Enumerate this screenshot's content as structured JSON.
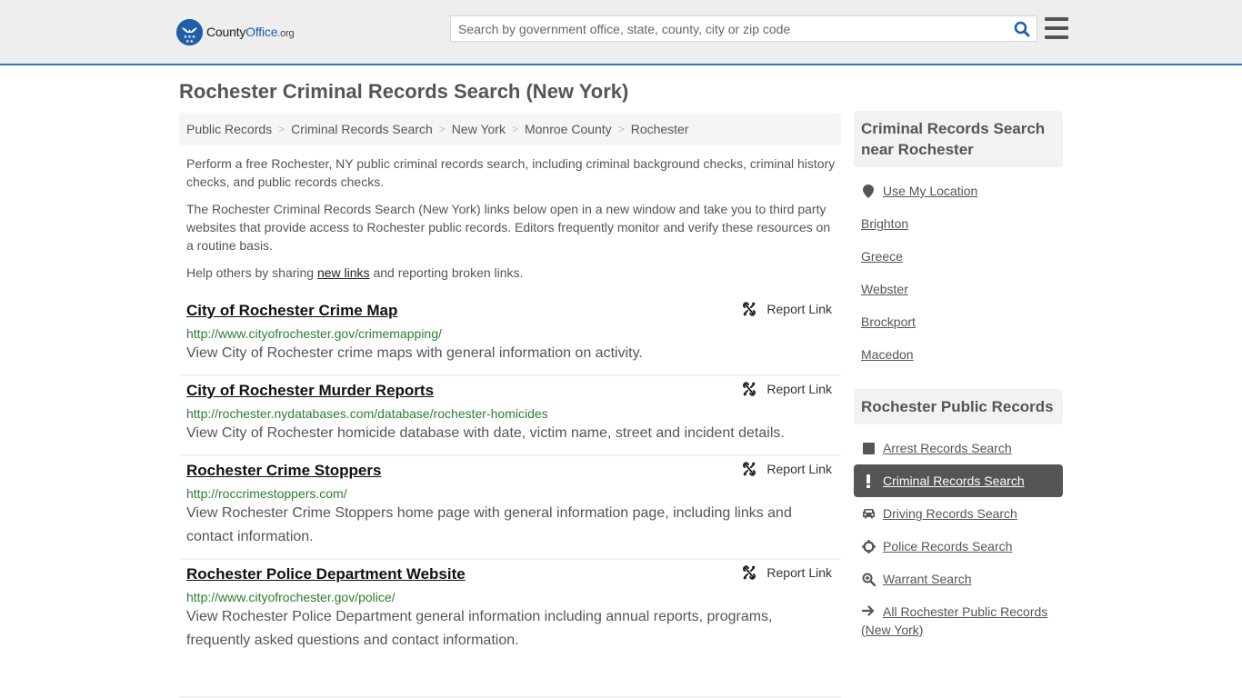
{
  "header": {
    "logo": {
      "name_part1": "County",
      "name_part2": "Office",
      "name_part3": ".org"
    },
    "search": {
      "placeholder": "Search by government office, state, county, city or zip code",
      "value": ""
    },
    "colors": {
      "accent": "#337ab7",
      "brand": "#1f5fa8"
    }
  },
  "page": {
    "title": "Rochester Criminal Records Search (New York)"
  },
  "breadcrumb": [
    {
      "label": "Public Records"
    },
    {
      "label": "Criminal Records Search"
    },
    {
      "label": "New York"
    },
    {
      "label": "Monroe County"
    },
    {
      "label": "Rochester"
    }
  ],
  "intro": {
    "p1": "Perform a free Rochester, NY public criminal records search, including criminal background checks, criminal history checks, and public records checks.",
    "p2": "The Rochester Criminal Records Search (New York) links below open in a new window and take you to third party websites that provide access to Rochester public records. Editors frequently monitor and verify these resources on a routine basis.",
    "p3_before": "Help others by sharing ",
    "p3_link": "new links",
    "p3_after": " and reporting broken links."
  },
  "results": [
    {
      "title": "City of Rochester Crime Map",
      "url": "http://www.cityofrochester.gov/crimemapping/",
      "description": "View City of Rochester crime maps with general information on activity.",
      "report_label": "Report Link"
    },
    {
      "title": "City of Rochester Murder Reports",
      "url": "http://rochester.nydatabases.com/database/rochester-homicides",
      "description": "View City of Rochester homicide database with date, victim name, street and incident details.",
      "report_label": "Report Link"
    },
    {
      "title": "Rochester Crime Stoppers",
      "url": "http://roccrimestoppers.com/",
      "description": "View Rochester Crime Stoppers home page with general information page, including links and contact information.",
      "report_label": "Report Link"
    },
    {
      "title": "Rochester Police Department Website",
      "url": "http://www.cityofrochester.gov/police/",
      "description": "View Rochester Police Department general information including annual reports, programs, frequently asked questions and contact information.",
      "report_label": "Report Link"
    }
  ],
  "sidebar_nearby": {
    "heading": "Criminal Records Search near Rochester",
    "use_location": {
      "label": "Use My Location",
      "icon": "map-marker-icon"
    },
    "places": [
      {
        "label": "Brighton"
      },
      {
        "label": "Greece"
      },
      {
        "label": "Webster"
      },
      {
        "label": "Brockport"
      },
      {
        "label": "Macedon"
      }
    ]
  },
  "sidebar_records": {
    "heading": "Rochester Public Records",
    "items": [
      {
        "label": "Arrest Records Search",
        "icon": "square-icon",
        "active": false
      },
      {
        "label": "Criminal Records Search",
        "icon": "exclamation-icon",
        "active": true
      },
      {
        "label": "Driving Records Search",
        "icon": "car-icon",
        "active": false
      },
      {
        "label": "Police Records Search",
        "icon": "crosshairs-icon",
        "active": false
      },
      {
        "label": "Warrant Search",
        "icon": "search-plus-icon",
        "active": false
      },
      {
        "label": "All Rochester Public Records (New York)",
        "icon": "arrow-right-icon",
        "active": false
      }
    ]
  }
}
